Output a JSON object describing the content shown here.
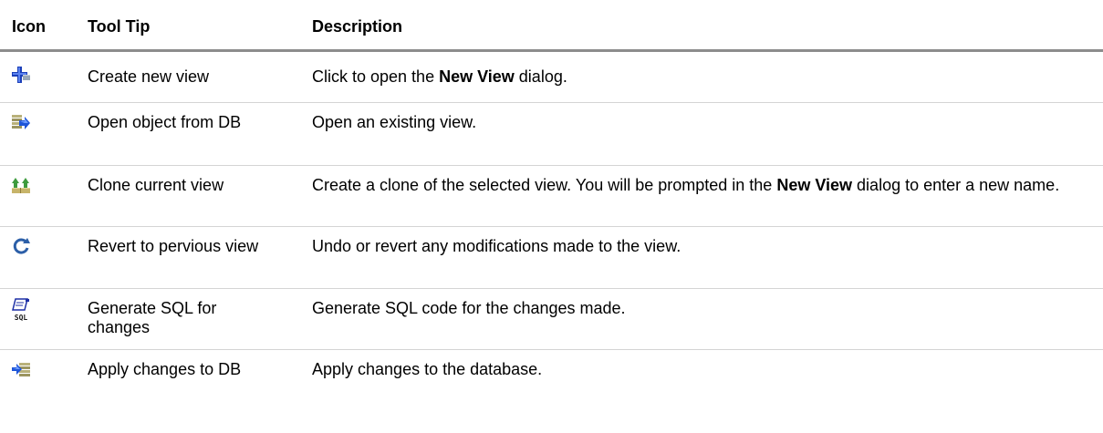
{
  "header": {
    "icon": "Icon",
    "tooltip": "Tool Tip",
    "description": "Description"
  },
  "rows": [
    {
      "icon": "create-new-view-icon",
      "tooltip": "Create new view",
      "desc_pre": "Click to open the ",
      "desc_bold": "New View",
      "desc_post": " dialog."
    },
    {
      "icon": "open-object-icon",
      "tooltip": "Open object from DB",
      "desc": "Open an existing view."
    },
    {
      "icon": "clone-view-icon",
      "tooltip": "Clone current view",
      "desc_pre": "Create a clone of the selected view. You will be prompted in the ",
      "desc_bold": "New View",
      "desc_post": " dialog to enter a new name."
    },
    {
      "icon": "revert-icon",
      "tooltip": "Revert to pervious view",
      "desc": "Undo or revert any modifications made to the view."
    },
    {
      "icon": "generate-sql-icon",
      "tooltip": "Generate SQL for changes",
      "desc": "Generate SQL code for the changes made.",
      "icon_text": "SQL"
    },
    {
      "icon": "apply-changes-icon",
      "tooltip": "Apply changes to DB",
      "desc": "Apply changes to the database."
    }
  ]
}
